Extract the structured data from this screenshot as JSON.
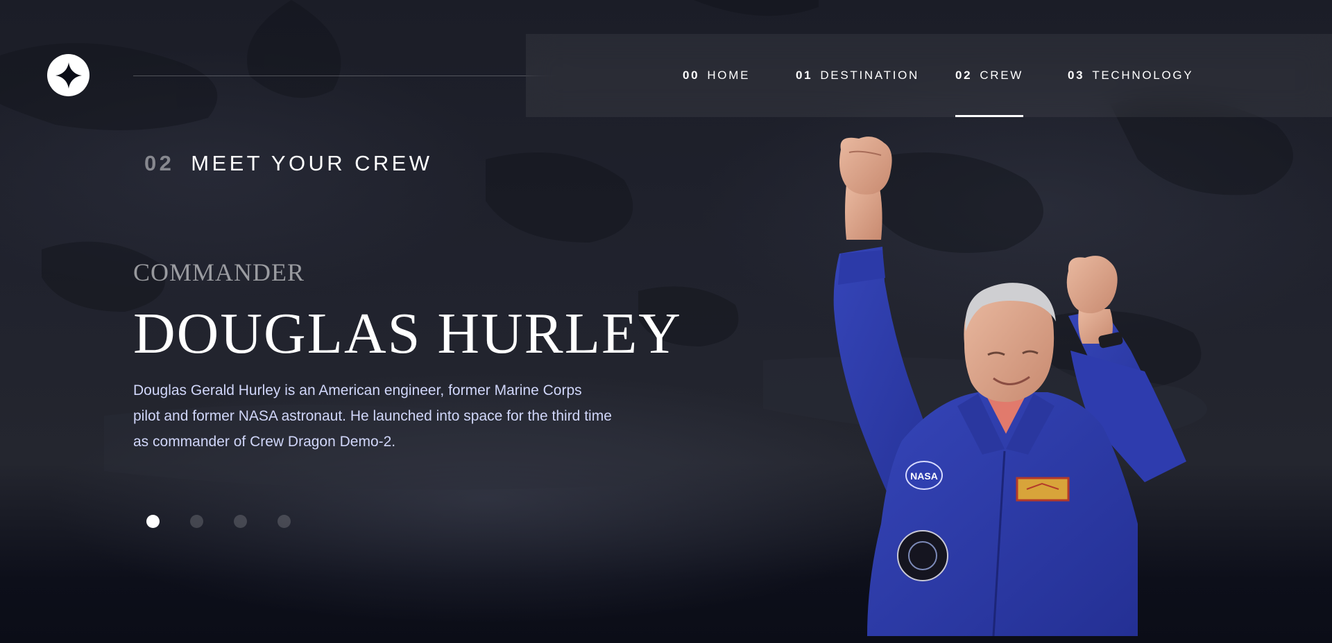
{
  "logo": {
    "icon": "star-icon"
  },
  "nav": {
    "items": [
      {
        "num": "00",
        "label": "HOME"
      },
      {
        "num": "01",
        "label": "DESTINATION"
      },
      {
        "num": "02",
        "label": "CREW",
        "active": true
      },
      {
        "num": "03",
        "label": "TECHNOLOGY"
      }
    ]
  },
  "heading": {
    "num": "02",
    "label": "MEET YOUR CREW"
  },
  "crew": {
    "role": "COMMANDER",
    "name": "DOUGLAS HURLEY",
    "bio": "Douglas Gerald Hurley is an American engineer, former Marine Corps pilot and former NASA astronaut. He launched into space for the third time as commander of Crew Dragon Demo-2.",
    "image_alt": "astronaut-photo",
    "patch_text": "NASA"
  },
  "slider": {
    "count": 4,
    "active_index": 0
  },
  "colors": {
    "background": "#0c0e18",
    "text": "#ffffff",
    "body_text": "#d0d6f9",
    "suit_blue": "#2d3aa6"
  }
}
